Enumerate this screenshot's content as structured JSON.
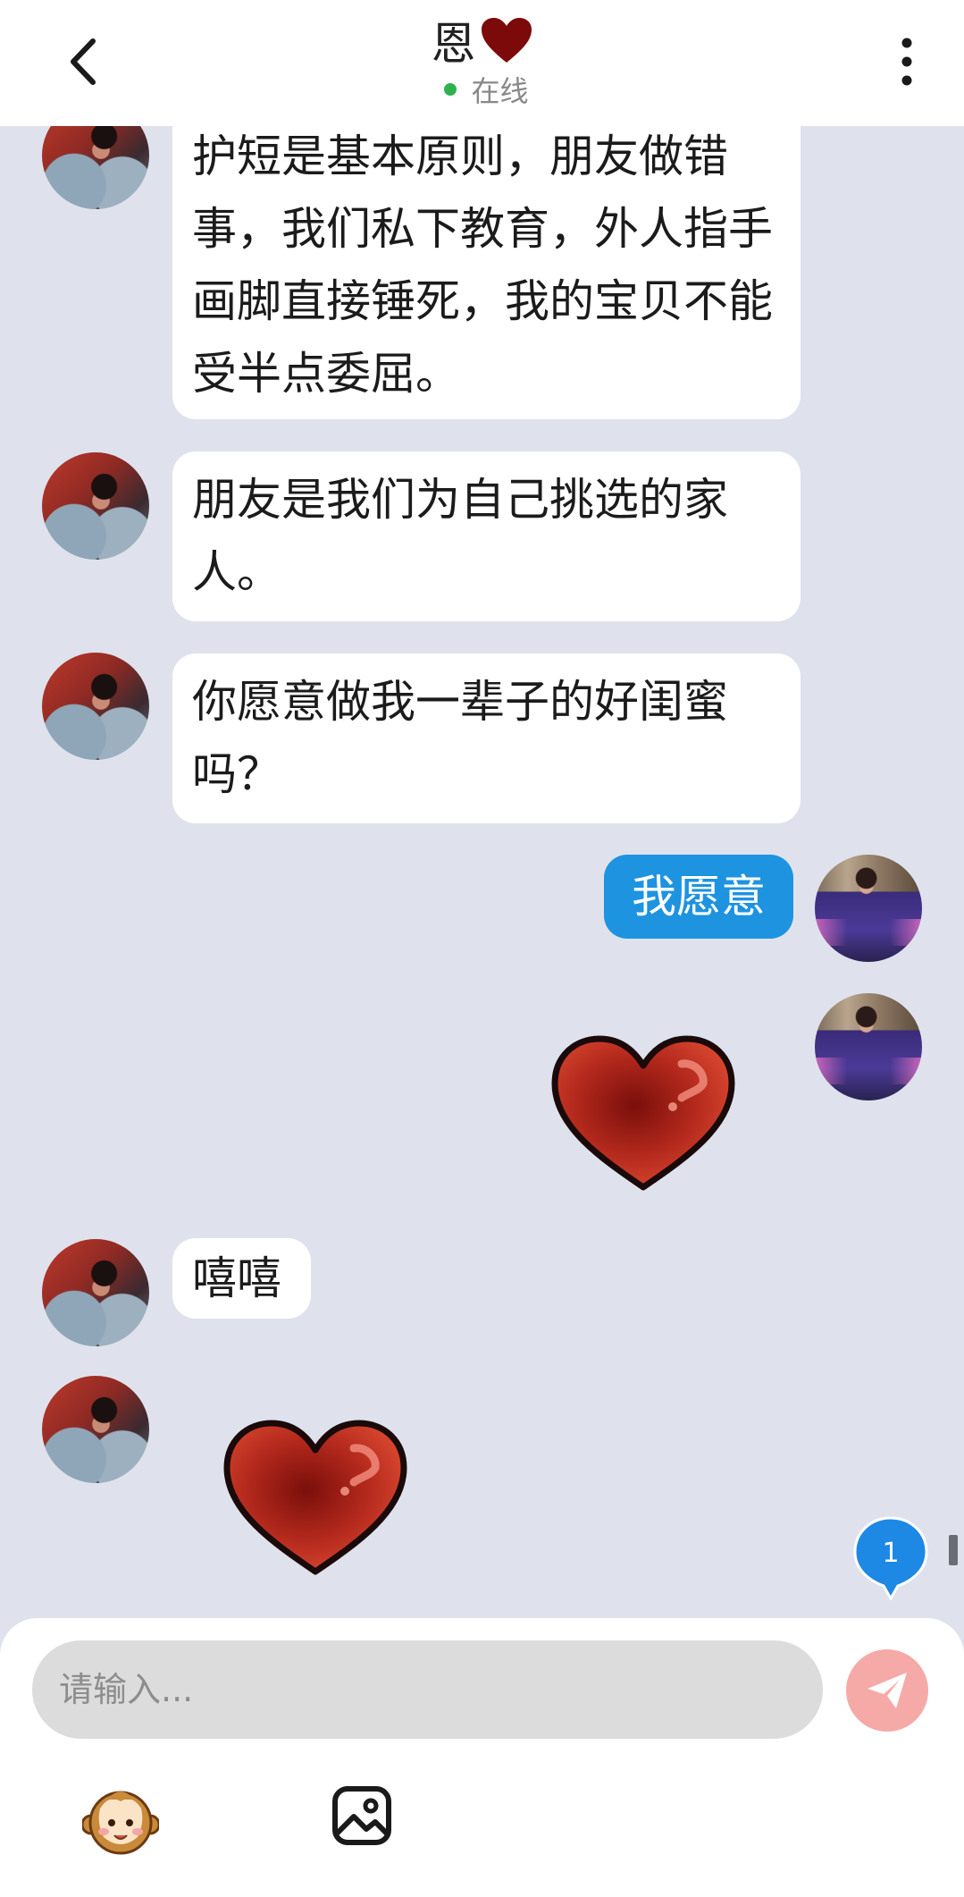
{
  "header": {
    "title": "恩",
    "status": "在线",
    "status_color": "#2db24f"
  },
  "messages": [
    {
      "from": "her",
      "text": "护短是基本原则，朋友做错事，我们私下教育，外人指手画脚直接锤死，我的宝贝不能受半点委屈。"
    },
    {
      "from": "her",
      "text": "朋友是我们为自己挑选的家人。"
    },
    {
      "from": "her",
      "text": "你愿意做我一辈子的好闺蜜吗？"
    },
    {
      "from": "me",
      "text": "我愿意"
    },
    {
      "from": "me",
      "sticker": "heart-sticker"
    },
    {
      "from": "her",
      "text": "嘻嘻"
    },
    {
      "from": "her",
      "sticker": "heart-sticker"
    }
  ],
  "unread_badge": "1",
  "composer": {
    "placeholder": "请输入...",
    "send_button_color": "#f5aaa7"
  },
  "toolbar": {
    "icons": [
      "monkey-emoji-icon",
      "image-icon"
    ]
  },
  "colors": {
    "background": "#dfe2ec",
    "my_bubble": "#1e93e0",
    "their_bubble": "#ffffff",
    "badge": "#1e88e5"
  }
}
